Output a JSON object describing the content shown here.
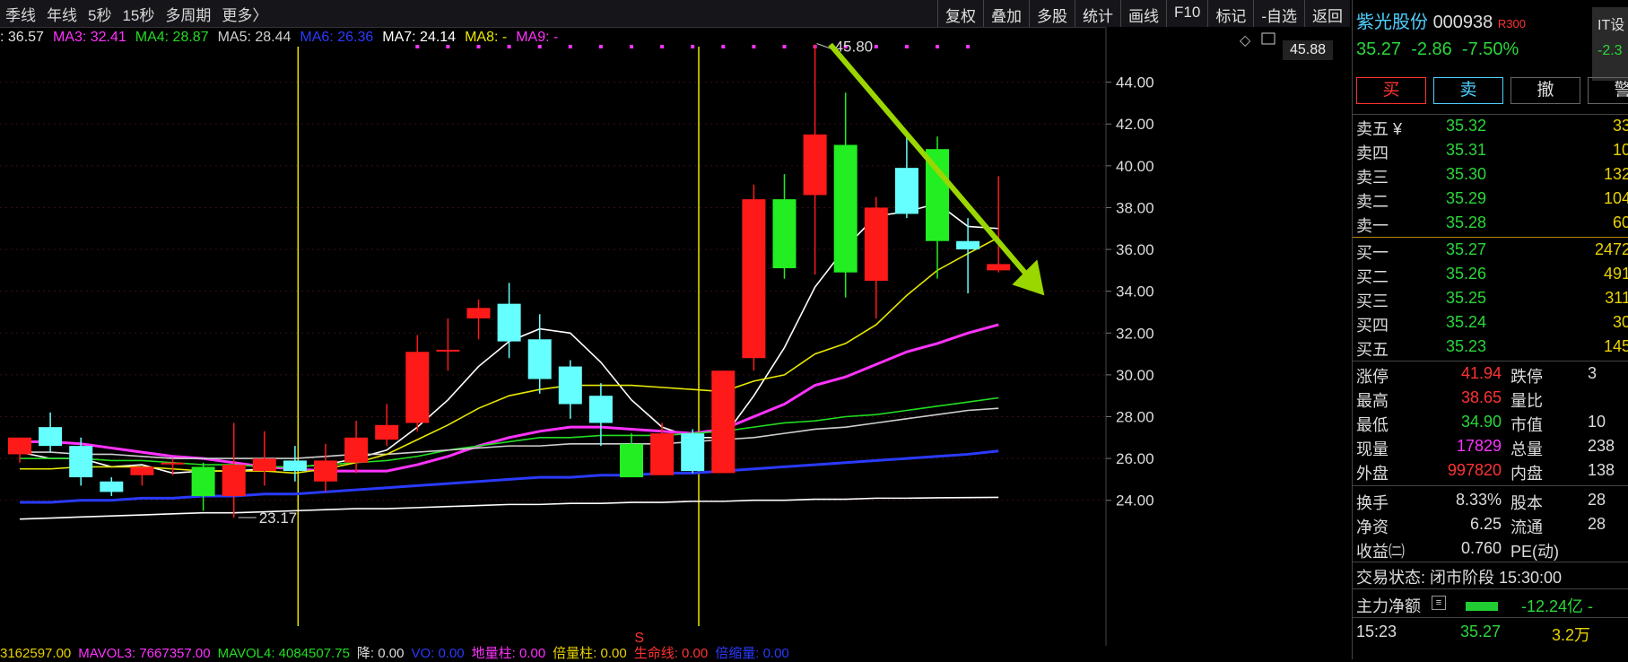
{
  "topbar": {
    "left_tabs": [
      "季线",
      "年线",
      "5秒",
      "15秒",
      "多周期",
      "更多〉"
    ],
    "right_tabs": [
      "复权",
      "叠加",
      "多股",
      "统计",
      "画线",
      "F10",
      "标记",
      "-自选",
      "返回"
    ]
  },
  "ma_bar": [
    {
      "text": ": 36.57",
      "color": "#e0e0e0"
    },
    {
      "text": "MA3: 32.41",
      "color": "#ff33ff"
    },
    {
      "text": "MA4: 28.87",
      "color": "#22dd22"
    },
    {
      "text": "MA5: 28.44",
      "color": "#cfcfcf"
    },
    {
      "text": "MA6: 26.36",
      "color": "#2a3aff"
    },
    {
      "text": "MA7: 24.14",
      "color": "#ffffff"
    },
    {
      "text": "MA8: -",
      "color": "#e8e800"
    },
    {
      "text": "MA9: -",
      "color": "#ff33ff"
    }
  ],
  "price_top_label": "45.88",
  "chart_data": {
    "type": "candlestick",
    "y_ticks": [
      24,
      26,
      28,
      30,
      32,
      34,
      36,
      38,
      40,
      42,
      44
    ],
    "ylim": [
      22.4,
      46
    ],
    "annotations": {
      "high_label": "45.80",
      "low_label": "23.17",
      "marker": "S"
    },
    "candles": [
      {
        "o": 26.2,
        "h": 27.0,
        "l": 25.8,
        "c": 27.0,
        "color": "red"
      },
      {
        "o": 27.5,
        "h": 28.2,
        "l": 26.3,
        "c": 26.6,
        "color": "cyan"
      },
      {
        "o": 26.6,
        "h": 27.0,
        "l": 24.7,
        "c": 25.1,
        "color": "cyan"
      },
      {
        "o": 24.9,
        "h": 25.1,
        "l": 24.2,
        "c": 24.4,
        "color": "cyan"
      },
      {
        "o": 25.2,
        "h": 25.6,
        "l": 24.7,
        "c": 25.6,
        "color": "red"
      },
      {
        "o": 25.8,
        "h": 26.0,
        "l": 25.2,
        "c": 25.8,
        "color": "red"
      },
      {
        "o": 25.6,
        "h": 25.8,
        "l": 23.5,
        "c": 24.2,
        "color": "green"
      },
      {
        "o": 24.2,
        "h": 27.7,
        "l": 23.17,
        "c": 25.7,
        "color": "red"
      },
      {
        "o": 25.4,
        "h": 27.3,
        "l": 24.7,
        "c": 26.0,
        "color": "red"
      },
      {
        "o": 25.9,
        "h": 26.6,
        "l": 24.9,
        "c": 25.4,
        "color": "cyan"
      },
      {
        "o": 24.9,
        "h": 26.7,
        "l": 24.4,
        "c": 25.9,
        "color": "red"
      },
      {
        "o": 25.8,
        "h": 27.8,
        "l": 25.3,
        "c": 27.0,
        "color": "red"
      },
      {
        "o": 26.9,
        "h": 28.6,
        "l": 26.6,
        "c": 27.6,
        "color": "red"
      },
      {
        "o": 27.7,
        "h": 31.9,
        "l": 27.3,
        "c": 31.1,
        "color": "red"
      },
      {
        "o": 31.2,
        "h": 32.7,
        "l": 30.2,
        "c": 31.2,
        "color": "red"
      },
      {
        "o": 32.7,
        "h": 33.6,
        "l": 31.7,
        "c": 33.2,
        "color": "red"
      },
      {
        "o": 33.4,
        "h": 34.4,
        "l": 30.8,
        "c": 31.6,
        "color": "cyan"
      },
      {
        "o": 31.7,
        "h": 32.9,
        "l": 29.1,
        "c": 29.8,
        "color": "cyan"
      },
      {
        "o": 30.4,
        "h": 30.7,
        "l": 27.9,
        "c": 28.6,
        "color": "cyan"
      },
      {
        "o": 29.0,
        "h": 29.6,
        "l": 26.6,
        "c": 27.7,
        "color": "cyan"
      },
      {
        "o": 26.7,
        "h": 27.2,
        "l": 25.1,
        "c": 25.1,
        "color": "green"
      },
      {
        "o": 27.2,
        "h": 27.7,
        "l": 25.2,
        "c": 25.2,
        "color": "red"
      },
      {
        "o": 27.2,
        "h": 27.4,
        "l": 25.3,
        "c": 25.4,
        "color": "cyan"
      },
      {
        "o": 30.2,
        "h": 30.2,
        "l": 25.3,
        "c": 25.3,
        "color": "red"
      },
      {
        "o": 38.4,
        "h": 39.1,
        "l": 30.2,
        "c": 30.8,
        "color": "red"
      },
      {
        "o": 38.4,
        "h": 39.6,
        "l": 34.6,
        "c": 35.1,
        "color": "green"
      },
      {
        "o": 41.5,
        "h": 45.8,
        "l": 34.8,
        "c": 38.6,
        "color": "red"
      },
      {
        "o": 41.0,
        "h": 43.5,
        "l": 33.7,
        "c": 34.9,
        "color": "green"
      },
      {
        "o": 38.0,
        "h": 38.5,
        "l": 32.7,
        "c": 34.5,
        "color": "red"
      },
      {
        "o": 39.9,
        "h": 41.6,
        "l": 37.5,
        "c": 37.7,
        "color": "cyan"
      },
      {
        "o": 40.8,
        "h": 41.4,
        "l": 34.6,
        "c": 36.4,
        "color": "green"
      },
      {
        "o": 36.4,
        "h": 37.5,
        "l": 33.9,
        "c": 36.0,
        "color": "cyan"
      },
      {
        "o": 35.3,
        "h": 39.5,
        "l": 34.9,
        "c": 35.0,
        "color": "red"
      }
    ],
    "lines": [
      {
        "name": "MA2",
        "color": "#ffffff",
        "values": [
          26.3,
          26.0,
          26.0,
          25.6,
          25.7,
          25.3,
          25.4,
          25.4,
          25.5,
          25.6,
          25.7,
          26.0,
          26.4,
          27.5,
          28.8,
          30.4,
          31.6,
          32.2,
          32.0,
          30.6,
          28.8,
          27.5,
          27.0,
          27.0,
          29.0,
          31.3,
          34.2,
          36.1,
          37.6,
          37.8,
          38.2,
          37.1,
          37.0
        ]
      },
      {
        "name": "MA3",
        "color": "#ff33ff",
        "values": [
          26.8,
          26.8,
          26.7,
          26.5,
          26.3,
          26.1,
          26.0,
          25.8,
          25.6,
          25.5,
          25.4,
          25.4,
          25.4,
          25.7,
          26.1,
          26.6,
          27.0,
          27.3,
          27.5,
          27.5,
          27.4,
          27.3,
          27.2,
          27.4,
          28.0,
          28.6,
          29.5,
          29.9,
          30.5,
          31.1,
          31.5,
          32.0,
          32.4
        ]
      },
      {
        "name": "MA4",
        "color": "#22dd22",
        "values": [
          26.0,
          26.0,
          26.0,
          25.9,
          25.9,
          25.8,
          25.7,
          25.7,
          25.6,
          25.6,
          25.7,
          25.8,
          25.9,
          26.1,
          26.4,
          26.6,
          26.8,
          27.0,
          27.0,
          27.1,
          27.1,
          27.1,
          27.2,
          27.3,
          27.5,
          27.7,
          27.8,
          28.0,
          28.1,
          28.3,
          28.5,
          28.7,
          28.9
        ]
      },
      {
        "name": "MA5",
        "color": "#cfcfcf",
        "values": [
          26.3,
          26.3,
          26.2,
          26.2,
          26.1,
          26.0,
          26.0,
          26.0,
          26.0,
          26.0,
          26.1,
          26.2,
          26.2,
          26.3,
          26.4,
          26.5,
          26.6,
          26.6,
          26.7,
          26.7,
          26.7,
          26.7,
          26.8,
          26.9,
          27.0,
          27.2,
          27.4,
          27.5,
          27.7,
          27.9,
          28.1,
          28.3,
          28.4
        ]
      },
      {
        "name": "MA6",
        "color": "#2a3aff",
        "values": [
          23.9,
          23.9,
          24.0,
          24.0,
          24.1,
          24.1,
          24.2,
          24.2,
          24.3,
          24.3,
          24.4,
          24.5,
          24.6,
          24.7,
          24.8,
          24.9,
          25.0,
          25.1,
          25.1,
          25.2,
          25.2,
          25.3,
          25.3,
          25.4,
          25.5,
          25.6,
          25.7,
          25.8,
          25.9,
          26.0,
          26.1,
          26.2,
          26.36
        ]
      },
      {
        "name": "MA7",
        "color": "#ffffff",
        "values": [
          23.1,
          23.15,
          23.2,
          23.25,
          23.3,
          23.35,
          23.4,
          23.4,
          23.45,
          23.5,
          23.55,
          23.6,
          23.6,
          23.65,
          23.7,
          23.75,
          23.8,
          23.8,
          23.85,
          23.85,
          23.9,
          23.9,
          23.95,
          23.95,
          24.0,
          24.0,
          24.05,
          24.05,
          24.1,
          24.1,
          24.12,
          24.13,
          24.14
        ]
      },
      {
        "name": "MA8",
        "color": "#e8e800",
        "values": [
          25.5,
          25.5,
          25.6,
          25.6,
          25.6,
          25.5,
          25.4,
          25.4,
          25.4,
          25.3,
          25.5,
          25.8,
          26.2,
          26.9,
          27.6,
          28.4,
          29.0,
          29.3,
          29.5,
          29.5,
          29.5,
          29.4,
          29.3,
          29.2,
          29.7,
          30.0,
          31.0,
          31.5,
          32.4,
          33.8,
          35.0,
          35.8,
          36.57
        ]
      }
    ],
    "vertical_markers": [
      9.1,
      22.2
    ],
    "arrow": {
      "from": [
        26.5,
        45.8
      ],
      "to": [
        33.5,
        33.8
      ]
    }
  },
  "bottom_bar": [
    {
      "text": "3162597.00",
      "color": "#e8d200"
    },
    {
      "text": "MAVOL3: 7667357.00",
      "color": "#ff33ff"
    },
    {
      "text": "MAVOL4: 4084507.75",
      "color": "#22dd22"
    },
    {
      "text": "降: 0.00",
      "color": "#dddddd"
    },
    {
      "text": "VO: 0.00",
      "color": "#2a3aff"
    },
    {
      "text": "地量柱: 0.00",
      "color": "#ff33ff"
    },
    {
      "text": "倍量柱: 0.00",
      "color": "#e8d200"
    },
    {
      "text": "生命线: 0.00",
      "color": "#ff3333"
    },
    {
      "text": "倍缩量: 0.00",
      "color": "#2a3aff"
    }
  ],
  "quote": {
    "name": "紫光股份",
    "code": "000938",
    "tag": "R300",
    "price": "35.27",
    "change": "-2.86",
    "change_pct": "-7.50%",
    "side_panel": "IT设",
    "side_change": "-2.3",
    "buttons": [
      "买",
      "卖",
      "撤",
      "警"
    ],
    "asks": [
      {
        "label": "卖五 ¥",
        "price": "35.32",
        "vol": "33"
      },
      {
        "label": "卖四",
        "price": "35.31",
        "vol": "10"
      },
      {
        "label": "卖三",
        "price": "35.30",
        "vol": "132"
      },
      {
        "label": "卖二",
        "price": "35.29",
        "vol": "104"
      },
      {
        "label": "卖一",
        "price": "35.28",
        "vol": "60"
      }
    ],
    "bids": [
      {
        "label": "买一",
        "price": "35.27",
        "vol": "2472"
      },
      {
        "label": "买二",
        "price": "35.26",
        "vol": "491"
      },
      {
        "label": "买三",
        "price": "35.25",
        "vol": "311"
      },
      {
        "label": "买四",
        "price": "35.24",
        "vol": "30"
      },
      {
        "label": "买五",
        "price": "35.23",
        "vol": "145"
      }
    ],
    "stats": [
      {
        "k1": "涨停",
        "v1": "41.94",
        "c1": "#ff3333",
        "k2": "跌停",
        "v2": "3"
      },
      {
        "k1": "最高",
        "v1": "38.65",
        "c1": "#ff3333",
        "k2": "量比",
        "v2": ""
      },
      {
        "k1": "最低",
        "v1": "34.90",
        "c1": "#2bd63a",
        "k2": "市值",
        "v2": "10"
      },
      {
        "k1": "现量",
        "v1": "17829",
        "c1": "#ff33ff",
        "k2": "总量",
        "v2": "238"
      },
      {
        "k1": "外盘",
        "v1": "997820",
        "c1": "#ff3333",
        "k2": "内盘",
        "v2": "138"
      }
    ],
    "stats2": [
      {
        "k1": "换手",
        "v1": "8.33%",
        "k2": "股本",
        "v2": "28"
      },
      {
        "k1": "净资",
        "v1": "6.25",
        "k2": "流通",
        "v2": "28"
      },
      {
        "k1": "收益㈡",
        "v1": "0.760",
        "k2": "PE(动)",
        "v2": ""
      }
    ],
    "trade_status": "交易状态: 闭市阶段 15:30:00",
    "main_flow_label": "主力净额",
    "main_flow_value": "-12.24亿 -",
    "tick_time": "15:23",
    "tick_price": "35.27",
    "tick_vol": "3.2万"
  }
}
